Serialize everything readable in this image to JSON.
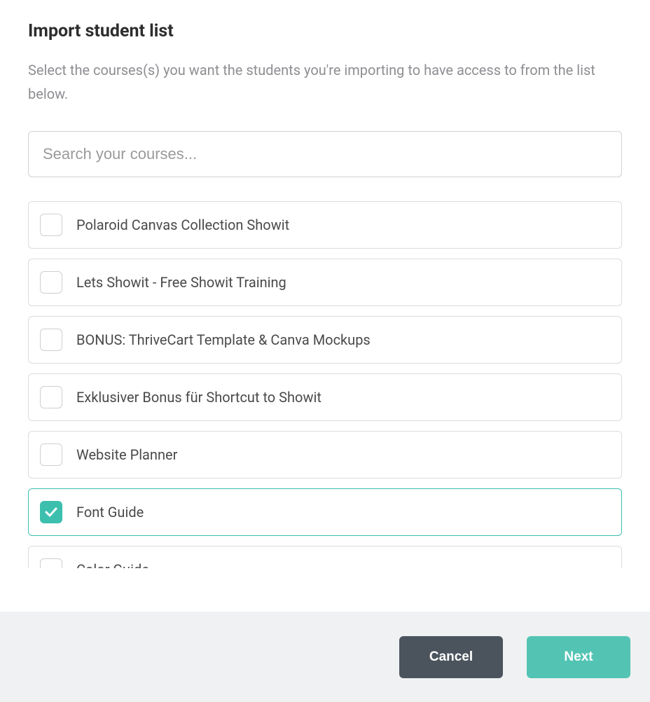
{
  "title": "Import student list",
  "subtitle": "Select the courses(s) you want the students you're importing to have access to from the list below.",
  "search": {
    "placeholder": "Search your courses...",
    "value": ""
  },
  "courses": [
    {
      "label": "Polaroid Canvas Collection Showit",
      "checked": false
    },
    {
      "label": "Lets Showit - Free Showit Training",
      "checked": false
    },
    {
      "label": "BONUS: ThriveCart Template & Canva Mockups",
      "checked": false
    },
    {
      "label": "Exklusiver Bonus für Shortcut to Showit",
      "checked": false
    },
    {
      "label": "Website Planner",
      "checked": false
    },
    {
      "label": "Font Guide",
      "checked": true
    },
    {
      "label": "Color Guide",
      "checked": false
    }
  ],
  "footer": {
    "cancel_label": "Cancel",
    "next_label": "Next"
  }
}
